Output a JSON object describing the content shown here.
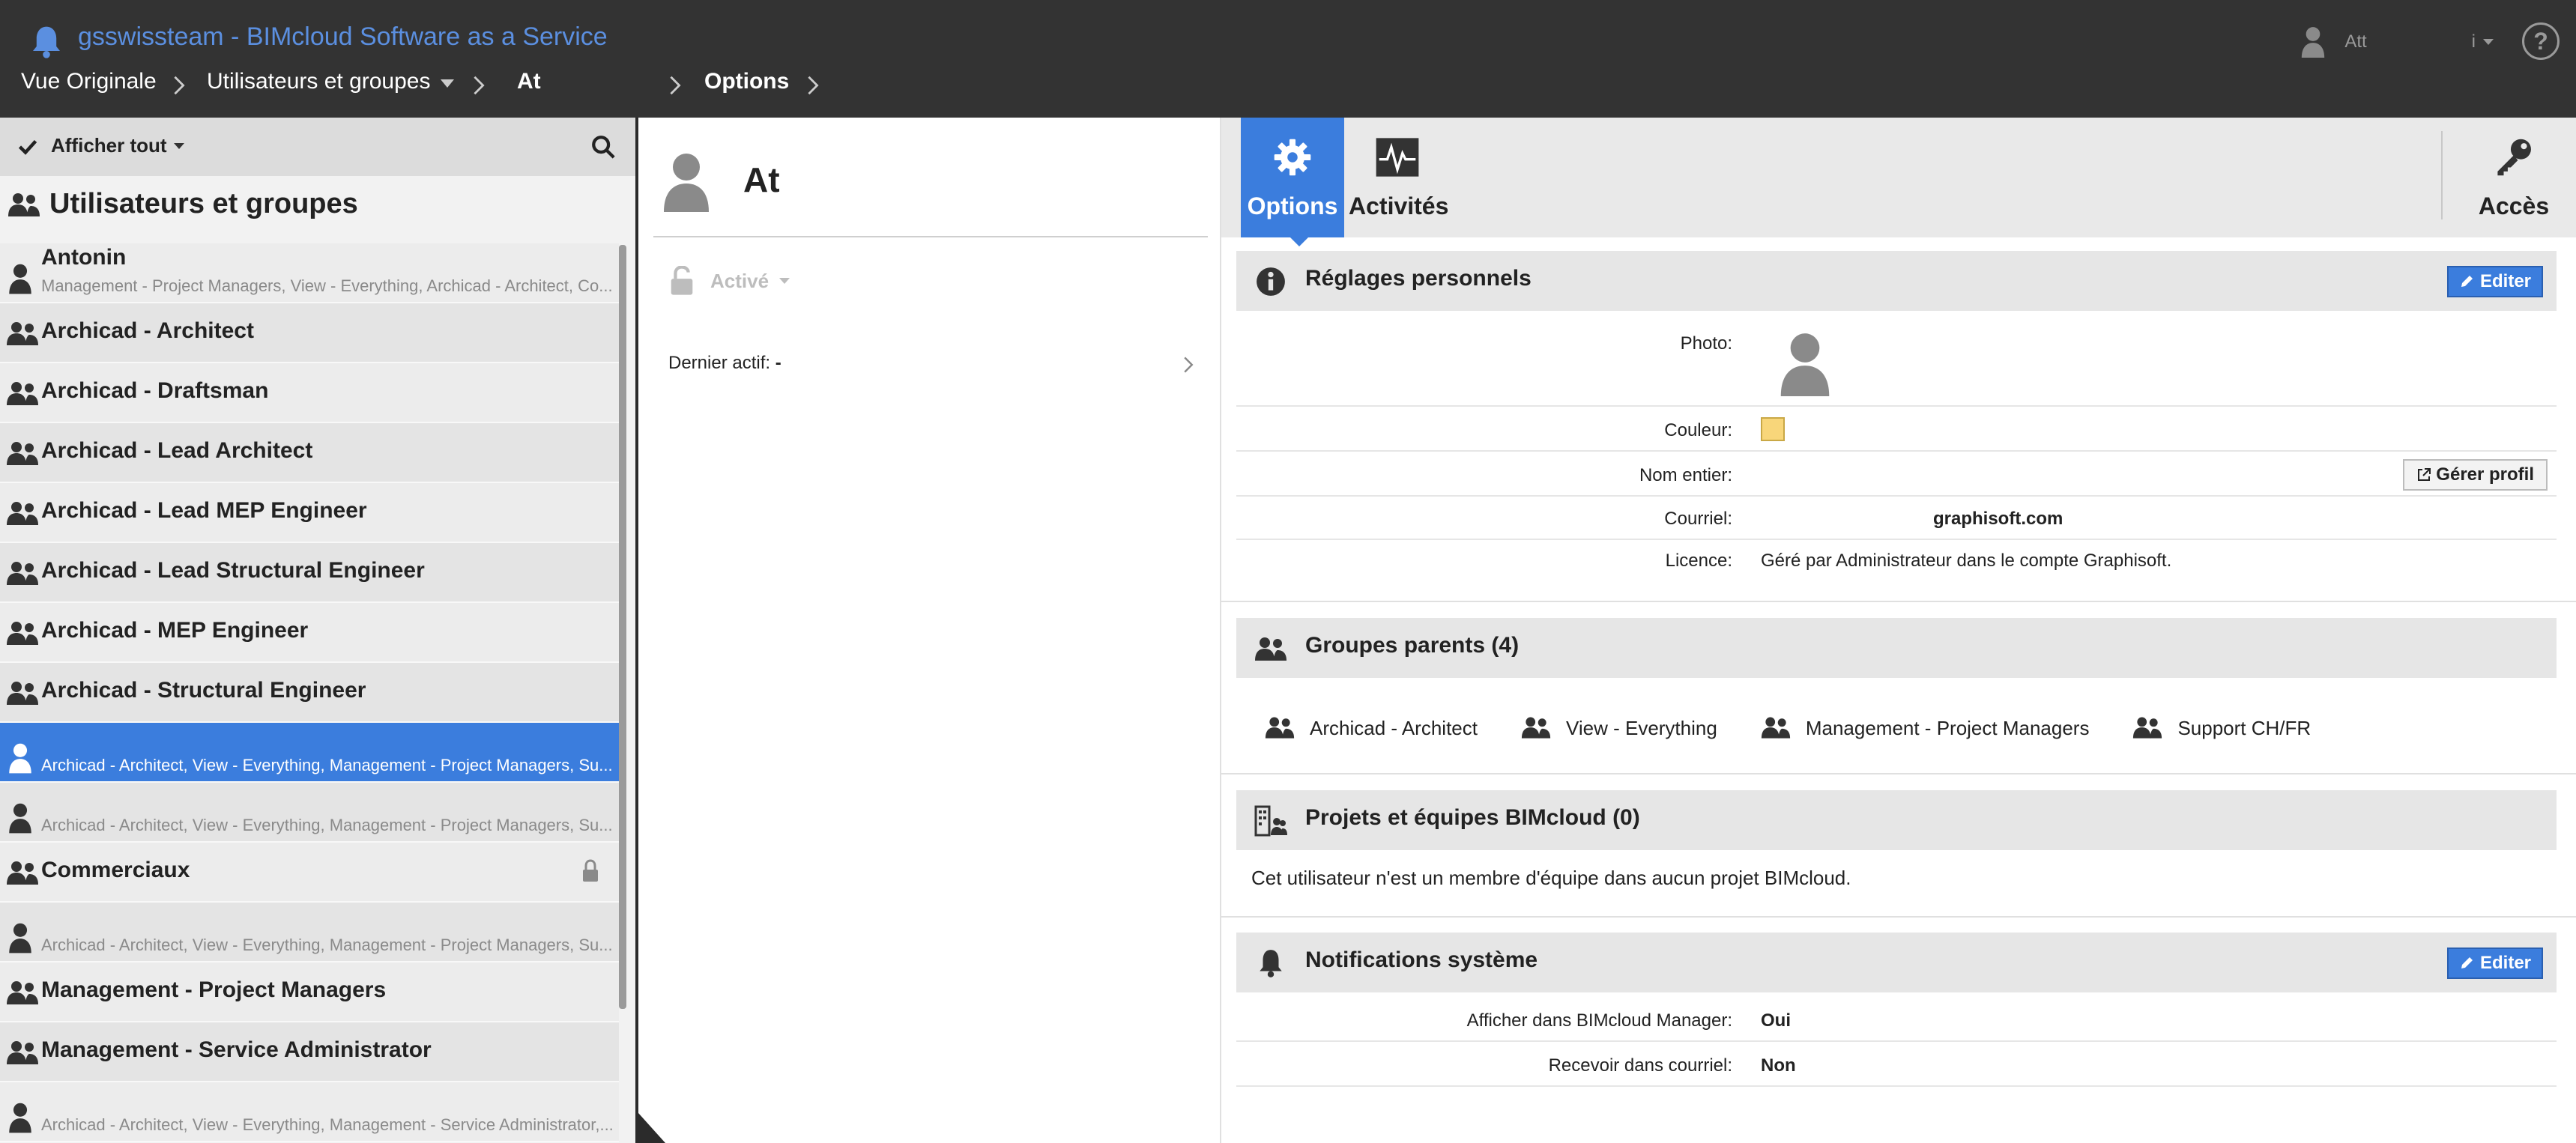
{
  "header": {
    "app_title": "gsswissteam - BIMcloud Software as a Service",
    "user_name": "Att",
    "user_menu_label": "i",
    "help_label": "?"
  },
  "breadcrumb": {
    "item1": "Vue Originale",
    "item2": "Utilisateurs et groupes",
    "item3": "At",
    "item4": "Options"
  },
  "left_panel": {
    "filter_label": "Afficher tout",
    "title": "Utilisateurs et groupes",
    "items": [
      {
        "type": "user",
        "name": "Antonin",
        "sub": "Management - Project Managers, View - Everything, Archicad - Architect, Co..."
      },
      {
        "type": "group",
        "name": "Archicad - Architect"
      },
      {
        "type": "group",
        "name": "Archicad - Draftsman"
      },
      {
        "type": "group",
        "name": "Archicad - Lead Architect"
      },
      {
        "type": "group",
        "name": "Archicad - Lead MEP Engineer"
      },
      {
        "type": "group",
        "name": "Archicad - Lead Structural Engineer"
      },
      {
        "type": "group",
        "name": "Archicad - MEP Engineer"
      },
      {
        "type": "group",
        "name": "Archicad - Structural Engineer"
      },
      {
        "type": "user",
        "name": "",
        "sub": "Archicad - Architect, View - Everything, Management - Project Managers, Su..."
      },
      {
        "type": "user",
        "name": "",
        "sub": "Archicad - Architect, View - Everything, Management - Project Managers, Su..."
      },
      {
        "type": "group",
        "name": "Commerciaux"
      },
      {
        "type": "user",
        "name": "",
        "sub": "Archicad - Architect, View - Everything, Management - Project Managers, Su..."
      },
      {
        "type": "group",
        "name": "Management - Project Managers"
      },
      {
        "type": "group",
        "name": "Management - Service Administrator"
      },
      {
        "type": "user",
        "name": "",
        "sub": "Archicad - Architect, View - Everything, Management - Service Administrator,..."
      }
    ]
  },
  "middle_panel": {
    "user_name": "At",
    "status": "Activé",
    "last_active_label": "Dernier actif:",
    "last_active_value": "-"
  },
  "tabs": {
    "options": "Options",
    "activities": "Activités",
    "access": "Accès"
  },
  "personal_settings": {
    "title": "Réglages personnels",
    "edit_label": "Editer",
    "photo_label": "Photo:",
    "color_label": "Couleur:",
    "color_value": "#f8d67a",
    "fullname_label": "Nom entier:",
    "manage_profile_label": "Gérer profil",
    "email_label": "Courriel:",
    "email_value": "graphisoft.com",
    "license_label": "Licence:",
    "license_value": "Géré par Administrateur dans le compte Graphisoft."
  },
  "parent_groups": {
    "title": "Groupes parents (4)",
    "items": [
      "Archicad - Architect",
      "View - Everything",
      "Management - Project Managers",
      "Support CH/FR"
    ]
  },
  "projects": {
    "title": "Projets et équipes BIMcloud (0)",
    "message": "Cet utilisateur n'est un membre d'équipe dans aucun projet BIMcloud."
  },
  "notifications": {
    "title": "Notifications système",
    "edit_label": "Editer",
    "show_in_manager_label": "Afficher dans BIMcloud Manager:",
    "show_in_manager_value": "Oui",
    "receive_by_email_label": "Recevoir dans courriel:",
    "receive_by_email_value": "Non"
  },
  "colors": {
    "accent": "#3b7ddd",
    "topbar": "#333333",
    "title_blue": "#5b8fe0"
  }
}
